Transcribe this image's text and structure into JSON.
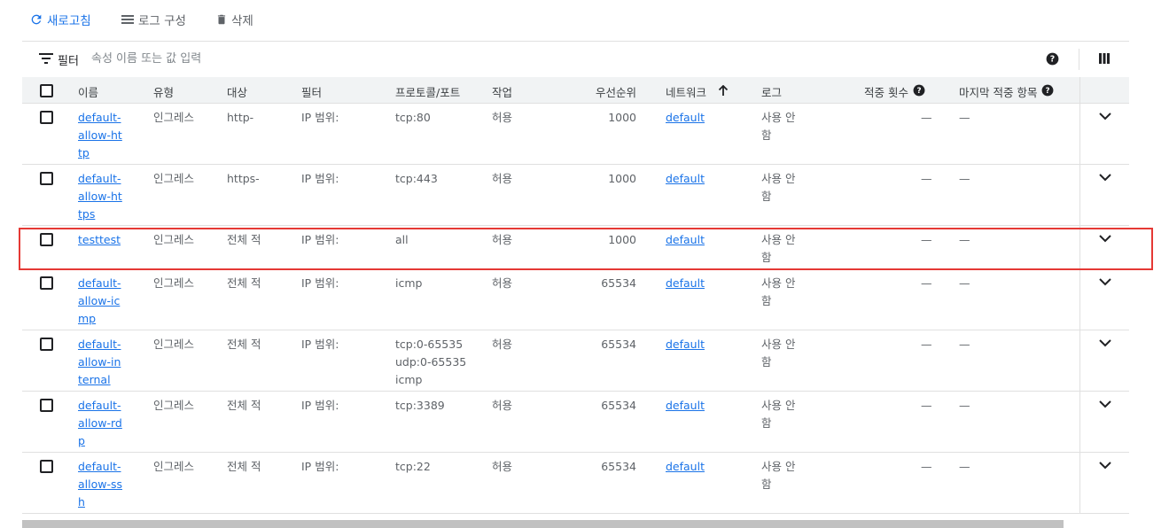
{
  "toolbar": {
    "refresh_label": "새로고침",
    "log_config_label": "로그 구성",
    "delete_label": "삭제"
  },
  "filter": {
    "label": "필터",
    "placeholder": "속성 이름 또는 값 입력"
  },
  "table": {
    "headers": {
      "name": "이름",
      "type": "유형",
      "targets": "대상",
      "filters": "필터",
      "protocol": "프로토콜/포트",
      "action": "작업",
      "priority": "우선순위",
      "network": "네트워크",
      "logs": "로그",
      "hit_count": "적중 횟수",
      "last_hit": "마지막 적중 항목"
    },
    "sort": {
      "column": "네트워크",
      "direction": "ascending"
    },
    "rows": [
      {
        "name": "default-allow-http",
        "type": "인그레스",
        "targets": "http-",
        "filters": "IP 범위:",
        "protocol": "tcp:80",
        "action": "허용",
        "priority": "1000",
        "network": "default",
        "logs": "사용 안 함",
        "hit_count": "—",
        "last_hit": "—"
      },
      {
        "name": "default-allow-https",
        "type": "인그레스",
        "targets": "https-",
        "filters": "IP 범위:",
        "protocol": "tcp:443",
        "action": "허용",
        "priority": "1000",
        "network": "default",
        "logs": "사용 안 함",
        "hit_count": "—",
        "last_hit": "—"
      },
      {
        "name": "testtest",
        "type": "인그레스",
        "targets": "전체 적",
        "filters": "IP 범위:",
        "protocol": "all",
        "action": "허용",
        "priority": "1000",
        "network": "default",
        "logs": "사용 안 함",
        "hit_count": "—",
        "last_hit": "—"
      },
      {
        "name": "default-allow-icmp",
        "type": "인그레스",
        "targets": "전체 적",
        "filters": "IP 범위:",
        "protocol": "icmp",
        "action": "허용",
        "priority": "65534",
        "network": "default",
        "logs": "사용 안 함",
        "hit_count": "—",
        "last_hit": "—"
      },
      {
        "name": "default-allow-internal",
        "type": "인그레스",
        "targets": "전체 적",
        "filters": "IP 범위:",
        "protocol": "tcp:0-65535 udp:0-65535 icmp",
        "action": "허용",
        "priority": "65534",
        "network": "default",
        "logs": "사용 안 함",
        "hit_count": "—",
        "last_hit": "—"
      },
      {
        "name": "default-allow-rdp",
        "type": "인그레스",
        "targets": "전체 적",
        "filters": "IP 범위:",
        "protocol": "tcp:3389",
        "action": "허용",
        "priority": "65534",
        "network": "default",
        "logs": "사용 안 함",
        "hit_count": "—",
        "last_hit": "—"
      },
      {
        "name": "default-allow-ssh",
        "type": "인그레스",
        "targets": "전체 적",
        "filters": "IP 범위:",
        "protocol": "tcp:22",
        "action": "허용",
        "priority": "65534",
        "network": "default",
        "logs": "사용 안 함",
        "hit_count": "—",
        "last_hit": "—"
      }
    ]
  },
  "colors": {
    "link": "#1a73e8",
    "header_bg": "#f1f3f4",
    "highlight_border": "#e53935"
  },
  "icons": {
    "refresh": "refresh-icon",
    "log_config": "list-icon",
    "delete": "trash-icon",
    "filter": "filter-icon",
    "help": "help-circle-icon",
    "columns": "column-display-icon",
    "sort": "arrow-up-icon",
    "expand": "chevron-down-icon"
  }
}
